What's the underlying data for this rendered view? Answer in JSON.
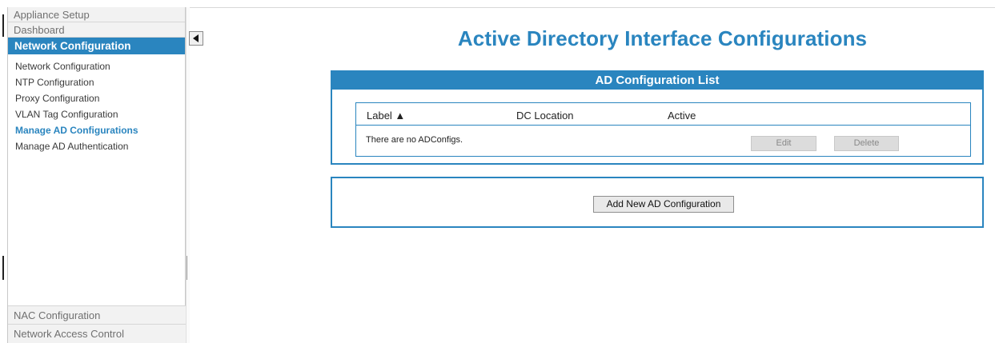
{
  "sidebar": {
    "top_items": [
      {
        "label": "Appliance Setup"
      },
      {
        "label": "Dashboard"
      }
    ],
    "section_title": "Network Configuration",
    "items": [
      {
        "label": "Network Configuration"
      },
      {
        "label": "NTP Configuration"
      },
      {
        "label": "Proxy Configuration"
      },
      {
        "label": "VLAN Tag Configuration"
      },
      {
        "label": "Manage AD Configurations",
        "active": true
      },
      {
        "label": "Manage AD Authentication"
      }
    ],
    "bottom_items": [
      {
        "label": "NAC Configuration"
      },
      {
        "label": "Network Access Control"
      }
    ]
  },
  "page": {
    "title": "Active Directory Interface Configurations"
  },
  "ad_list": {
    "header": "AD Configuration List",
    "columns": {
      "label": "Label ▲",
      "dc_location": "DC Location",
      "active": "Active"
    },
    "empty_message": "There are no ADConfigs.",
    "edit_label": "Edit",
    "delete_label": "Delete"
  },
  "add_panel": {
    "add_label": "Add New AD Configuration"
  },
  "colors": {
    "accent": "#2a85bf"
  },
  "icons": {
    "collapse": "triangle-left-icon"
  }
}
